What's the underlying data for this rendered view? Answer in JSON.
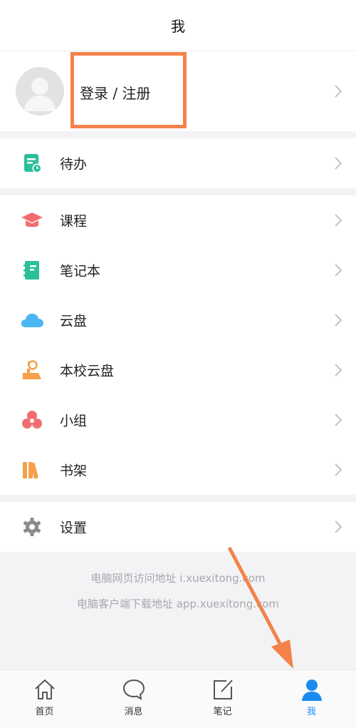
{
  "header": {
    "title": "我"
  },
  "profile": {
    "login_label": "登录 / 注册"
  },
  "groups": [
    {
      "items": [
        {
          "label": "待办",
          "icon": "todo-icon"
        }
      ]
    },
    {
      "items": [
        {
          "label": "课程",
          "icon": "graduation-cap-icon"
        },
        {
          "label": "笔记本",
          "icon": "notebook-icon"
        },
        {
          "label": "云盘",
          "icon": "cloud-icon"
        },
        {
          "label": "本校云盘",
          "icon": "school-cloud-icon"
        },
        {
          "label": "小组",
          "icon": "group-icon"
        },
        {
          "label": "书架",
          "icon": "bookshelf-icon"
        }
      ]
    },
    {
      "items": [
        {
          "label": "设置",
          "icon": "gear-icon"
        }
      ]
    }
  ],
  "footer": {
    "web_address": "电脑网页访问地址 i.xuexitong.com",
    "client_download": "电脑客户端下载地址 app.xuexitong.com"
  },
  "tabbar": {
    "tabs": [
      {
        "label": "首页",
        "icon": "home-icon"
      },
      {
        "label": "消息",
        "icon": "chat-bubble-icon"
      },
      {
        "label": "笔记",
        "icon": "note-edit-icon"
      },
      {
        "label": "我",
        "icon": "person-icon"
      }
    ],
    "active_index": 3
  },
  "colors": {
    "accent": "#1a8cf0",
    "highlight": "#f4824a",
    "todo": "#2bbf9a",
    "course": "#f26d6d",
    "notebook": "#2bbf9a",
    "cloud": "#4cb6f2",
    "school_cloud": "#f5a04a",
    "group": "#f26d6d",
    "bookshelf": "#f5a04a",
    "settings": "#8a8a8e"
  }
}
